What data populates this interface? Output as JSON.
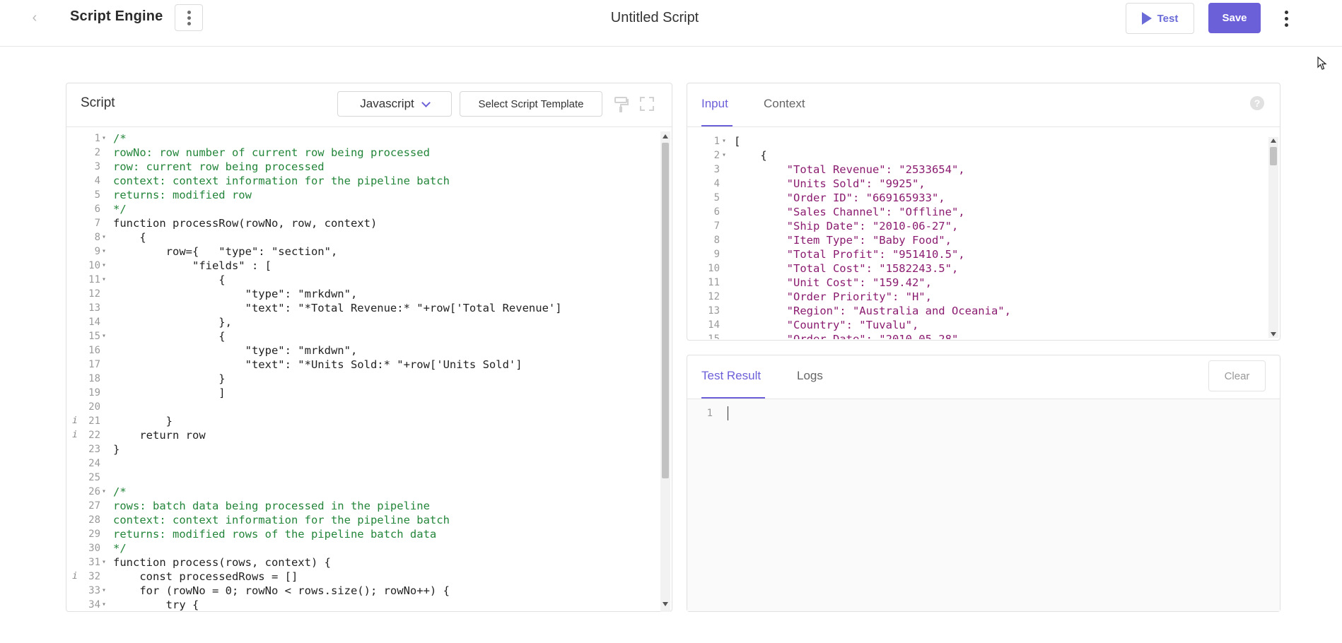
{
  "topbar": {
    "app_title": "Script Engine",
    "doc_title": "Untitled Script",
    "test_label": "Test",
    "save_label": "Save"
  },
  "colors": {
    "accent": "#6c60d8",
    "comment": "#23853a",
    "keyword": "#1d2aa3",
    "json_string": "#8a1b6f"
  },
  "script_panel": {
    "title": "Script",
    "language": "Javascript",
    "template_label": "Select Script Template",
    "lines": [
      {
        "n": "1",
        "fold": true,
        "info": false,
        "text": "/*"
      },
      {
        "n": "2",
        "fold": false,
        "info": false,
        "text": "rowNo: row number of current row being processed"
      },
      {
        "n": "3",
        "fold": false,
        "info": false,
        "text": "row: current row being processed"
      },
      {
        "n": "4",
        "fold": false,
        "info": false,
        "text": "context: context information for the pipeline batch"
      },
      {
        "n": "5",
        "fold": false,
        "info": false,
        "text": "returns: modified row"
      },
      {
        "n": "6",
        "fold": false,
        "info": false,
        "text": "*/"
      },
      {
        "n": "7",
        "fold": false,
        "info": false,
        "text": "function processRow(rowNo, row, context)"
      },
      {
        "n": "8",
        "fold": true,
        "info": false,
        "text": "    {"
      },
      {
        "n": "9",
        "fold": true,
        "info": false,
        "text": "        row={   \"type\": \"section\","
      },
      {
        "n": "10",
        "fold": true,
        "info": false,
        "text": "            \"fields\" : ["
      },
      {
        "n": "11",
        "fold": true,
        "info": false,
        "text": "                {"
      },
      {
        "n": "12",
        "fold": false,
        "info": false,
        "text": "                    \"type\": \"mrkdwn\","
      },
      {
        "n": "13",
        "fold": false,
        "info": false,
        "text": "                    \"text\": \"*Total Revenue:* \"+row['Total Revenue']"
      },
      {
        "n": "14",
        "fold": false,
        "info": false,
        "text": "                },"
      },
      {
        "n": "15",
        "fold": true,
        "info": false,
        "text": "                {"
      },
      {
        "n": "16",
        "fold": false,
        "info": false,
        "text": "                    \"type\": \"mrkdwn\","
      },
      {
        "n": "17",
        "fold": false,
        "info": false,
        "text": "                    \"text\": \"*Units Sold:* \"+row['Units Sold']"
      },
      {
        "n": "18",
        "fold": false,
        "info": false,
        "text": "                }"
      },
      {
        "n": "19",
        "fold": false,
        "info": false,
        "text": "                ]"
      },
      {
        "n": "20",
        "fold": false,
        "info": false,
        "text": ""
      },
      {
        "n": "21",
        "fold": false,
        "info": true,
        "text": "        }"
      },
      {
        "n": "22",
        "fold": false,
        "info": true,
        "text": "    return row"
      },
      {
        "n": "23",
        "fold": false,
        "info": false,
        "text": "}"
      },
      {
        "n": "24",
        "fold": false,
        "info": false,
        "text": ""
      },
      {
        "n": "25",
        "fold": false,
        "info": false,
        "text": ""
      },
      {
        "n": "26",
        "fold": true,
        "info": false,
        "text": "/*"
      },
      {
        "n": "27",
        "fold": false,
        "info": false,
        "text": "rows: batch data being processed in the pipeline"
      },
      {
        "n": "28",
        "fold": false,
        "info": false,
        "text": "context: context information for the pipeline batch"
      },
      {
        "n": "29",
        "fold": false,
        "info": false,
        "text": "returns: modified rows of the pipeline batch data"
      },
      {
        "n": "30",
        "fold": false,
        "info": false,
        "text": "*/"
      },
      {
        "n": "31",
        "fold": true,
        "info": false,
        "text": "function process(rows, context) {"
      },
      {
        "n": "32",
        "fold": false,
        "info": true,
        "text": "    const processedRows = []"
      },
      {
        "n": "33",
        "fold": true,
        "info": false,
        "text": "    for (rowNo = 0; rowNo < rows.size(); rowNo++) {"
      },
      {
        "n": "34",
        "fold": true,
        "info": false,
        "text": "        try {"
      }
    ]
  },
  "input_panel": {
    "tab_input": "Input",
    "tab_context": "Context",
    "lines": [
      {
        "n": "1",
        "fold": true,
        "text": "["
      },
      {
        "n": "2",
        "fold": true,
        "text": "    {"
      },
      {
        "n": "3",
        "fold": false,
        "text": "        \"Total Revenue\": \"2533654\","
      },
      {
        "n": "4",
        "fold": false,
        "text": "        \"Units Sold\": \"9925\","
      },
      {
        "n": "5",
        "fold": false,
        "text": "        \"Order ID\": \"669165933\","
      },
      {
        "n": "6",
        "fold": false,
        "text": "        \"Sales Channel\": \"Offline\","
      },
      {
        "n": "7",
        "fold": false,
        "text": "        \"Ship Date\": \"2010-06-27\","
      },
      {
        "n": "8",
        "fold": false,
        "text": "        \"Item Type\": \"Baby Food\","
      },
      {
        "n": "9",
        "fold": false,
        "text": "        \"Total Profit\": \"951410.5\","
      },
      {
        "n": "10",
        "fold": false,
        "text": "        \"Total Cost\": \"1582243.5\","
      },
      {
        "n": "11",
        "fold": false,
        "text": "        \"Unit Cost\": \"159.42\","
      },
      {
        "n": "12",
        "fold": false,
        "text": "        \"Order Priority\": \"H\","
      },
      {
        "n": "13",
        "fold": false,
        "text": "        \"Region\": \"Australia and Oceania\","
      },
      {
        "n": "14",
        "fold": false,
        "text": "        \"Country\": \"Tuvalu\","
      },
      {
        "n": "15",
        "fold": false,
        "text": "        \"Order Date\": \"2010-05-28\","
      }
    ]
  },
  "result_panel": {
    "tab_result": "Test Result",
    "tab_logs": "Logs",
    "clear_label": "Clear",
    "line_number": "1"
  }
}
